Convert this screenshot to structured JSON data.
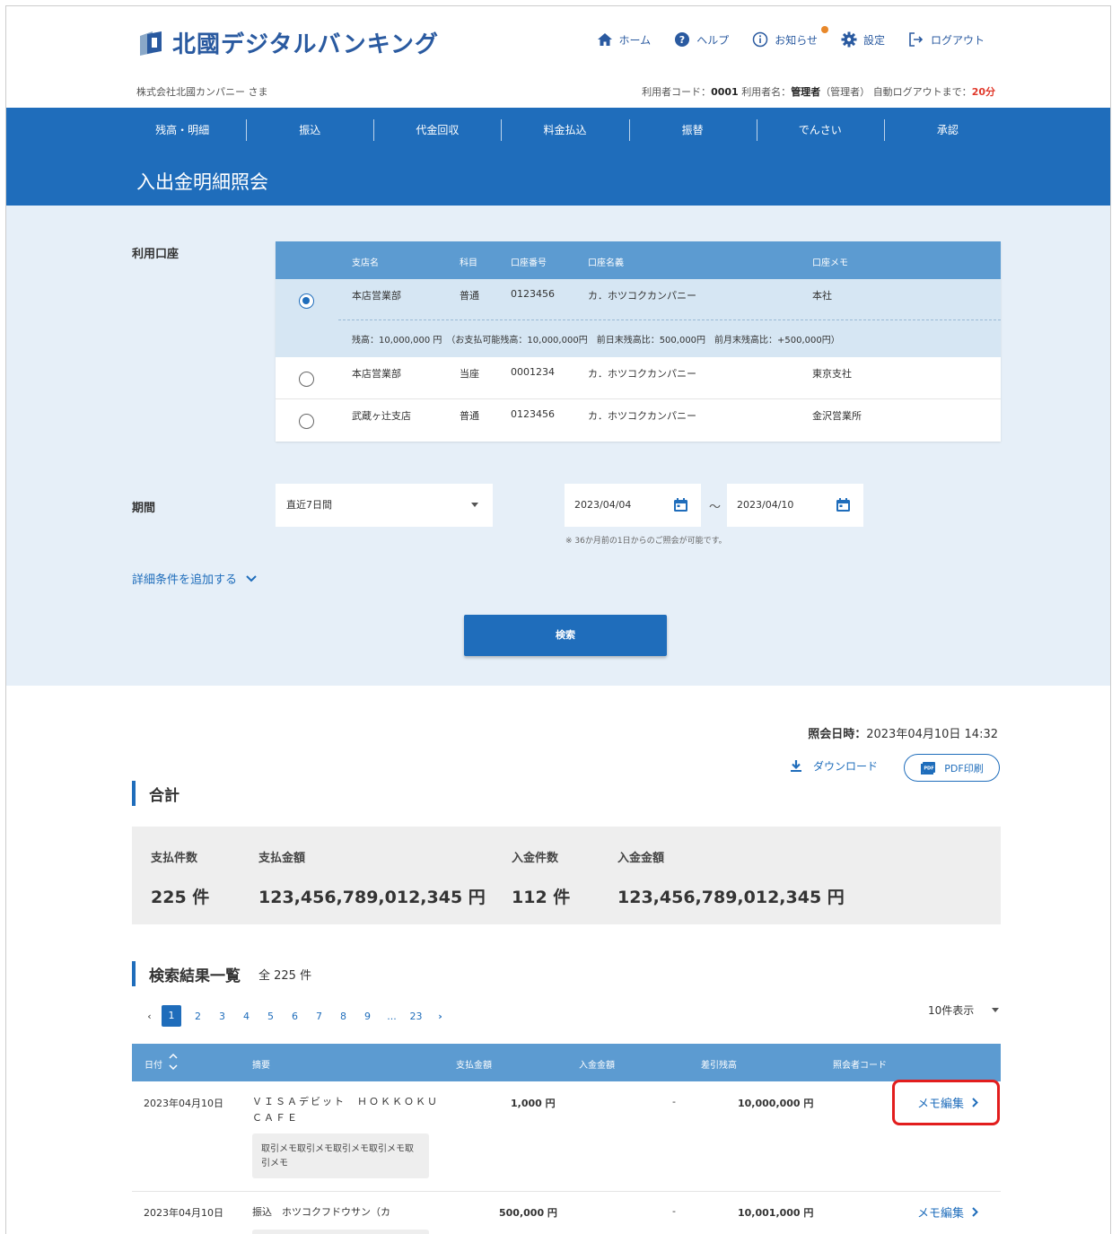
{
  "header": {
    "logo_text": "北國デジタルバンキング",
    "topnav": [
      {
        "label": "ホーム",
        "icon": "home-icon"
      },
      {
        "label": "ヘルプ",
        "icon": "help-icon"
      },
      {
        "label": "お知らせ",
        "icon": "info-icon"
      },
      {
        "label": "設定",
        "icon": "gear-icon"
      },
      {
        "label": "ログアウト",
        "icon": "logout-icon"
      }
    ],
    "company": "株式会社北國カンパニー さま",
    "user_code_label": "利用者コード：",
    "user_code": "0001",
    "user_name_label": "利用者名：",
    "user_name": "管理者",
    "user_role": "（管理者）",
    "auto_logout_label": "自動ログアウトまで：",
    "auto_logout": "20分"
  },
  "mainnav": [
    "残高・明細",
    "振込",
    "代金回収",
    "料金払込",
    "振替",
    "でんさい",
    "承認"
  ],
  "page_title": "入出金明細照会",
  "form": {
    "account_label": "利用口座",
    "account_columns": [
      "支店名",
      "科目",
      "口座番号",
      "口座名義",
      "口座メモ"
    ],
    "accounts": [
      {
        "branch": "本店営業部",
        "type": "普通",
        "number": "0123456",
        "holder": "カ．ホツコクカンパニー",
        "memo": "本社",
        "selected": true
      },
      {
        "branch": "本店営業部",
        "type": "当座",
        "number": "0001234",
        "holder": "カ．ホツコクカンパニー",
        "memo": "東京支社",
        "selected": false
      },
      {
        "branch": "武蔵ヶ辻支店",
        "type": "普通",
        "number": "0123456",
        "holder": "カ．ホツコクカンパニー",
        "memo": "金沢営業所",
        "selected": false
      }
    ],
    "balance_text": "残高：10,000,000 円　（お支払可能残高：10,000,000円　前日末残高比：500,000円　前月末残高比：+500,000円）",
    "period_label": "期間",
    "period_value": "直近7日間",
    "date_from": "2023/04/04",
    "date_to": "2023/04/10",
    "tilde": "～",
    "date_note": "※ 36か月前の1日からのご照会が可能です。",
    "detail_link": "詳細条件を追加する",
    "search_button": "検索"
  },
  "results": {
    "query_time_label": "照会日時：",
    "query_time": "2023年04月10日 14:32",
    "download_label": "ダウンロード",
    "pdf_label": "PDF印刷",
    "totals_title": "合計",
    "totals": [
      {
        "label": "支払件数",
        "value": "225 件"
      },
      {
        "label": "支払金額",
        "value": "123,456,789,012,345 円"
      },
      {
        "label": "入金件数",
        "value": "112 件"
      },
      {
        "label": "入金金額",
        "value": "123,456,789,012,345 円"
      }
    ],
    "list_title": "検索結果一覧",
    "list_count": "全 225 件",
    "pages": [
      "1",
      "2",
      "3",
      "4",
      "5",
      "6",
      "7",
      "8",
      "9",
      "...",
      "23"
    ],
    "per_page": "10件表示",
    "columns": [
      "日付",
      "摘要",
      "支払金額",
      "入金金額",
      "差引残高",
      "照会者コード"
    ],
    "rows": [
      {
        "date": "2023年04月10日",
        "desc": "ＶＩＳＡデビット　ＨＯＫＫＯＫＵ",
        "desc2": "ＣＡＦＥ",
        "pay": "1,000 円",
        "deposit": "-",
        "balance": "10,000,000 円",
        "memo": "取引メモ取引メモ取引メモ取引メモ取引メモ",
        "memo_link": "メモ編集"
      },
      {
        "date": "2023年04月10日",
        "desc": "振込　ホツコクフドウサン（カ",
        "desc2": "",
        "pay": "500,000 円",
        "deposit": "-",
        "balance": "10,001,000 円",
        "memo": "",
        "memo_link": "メモ編集"
      }
    ]
  }
}
